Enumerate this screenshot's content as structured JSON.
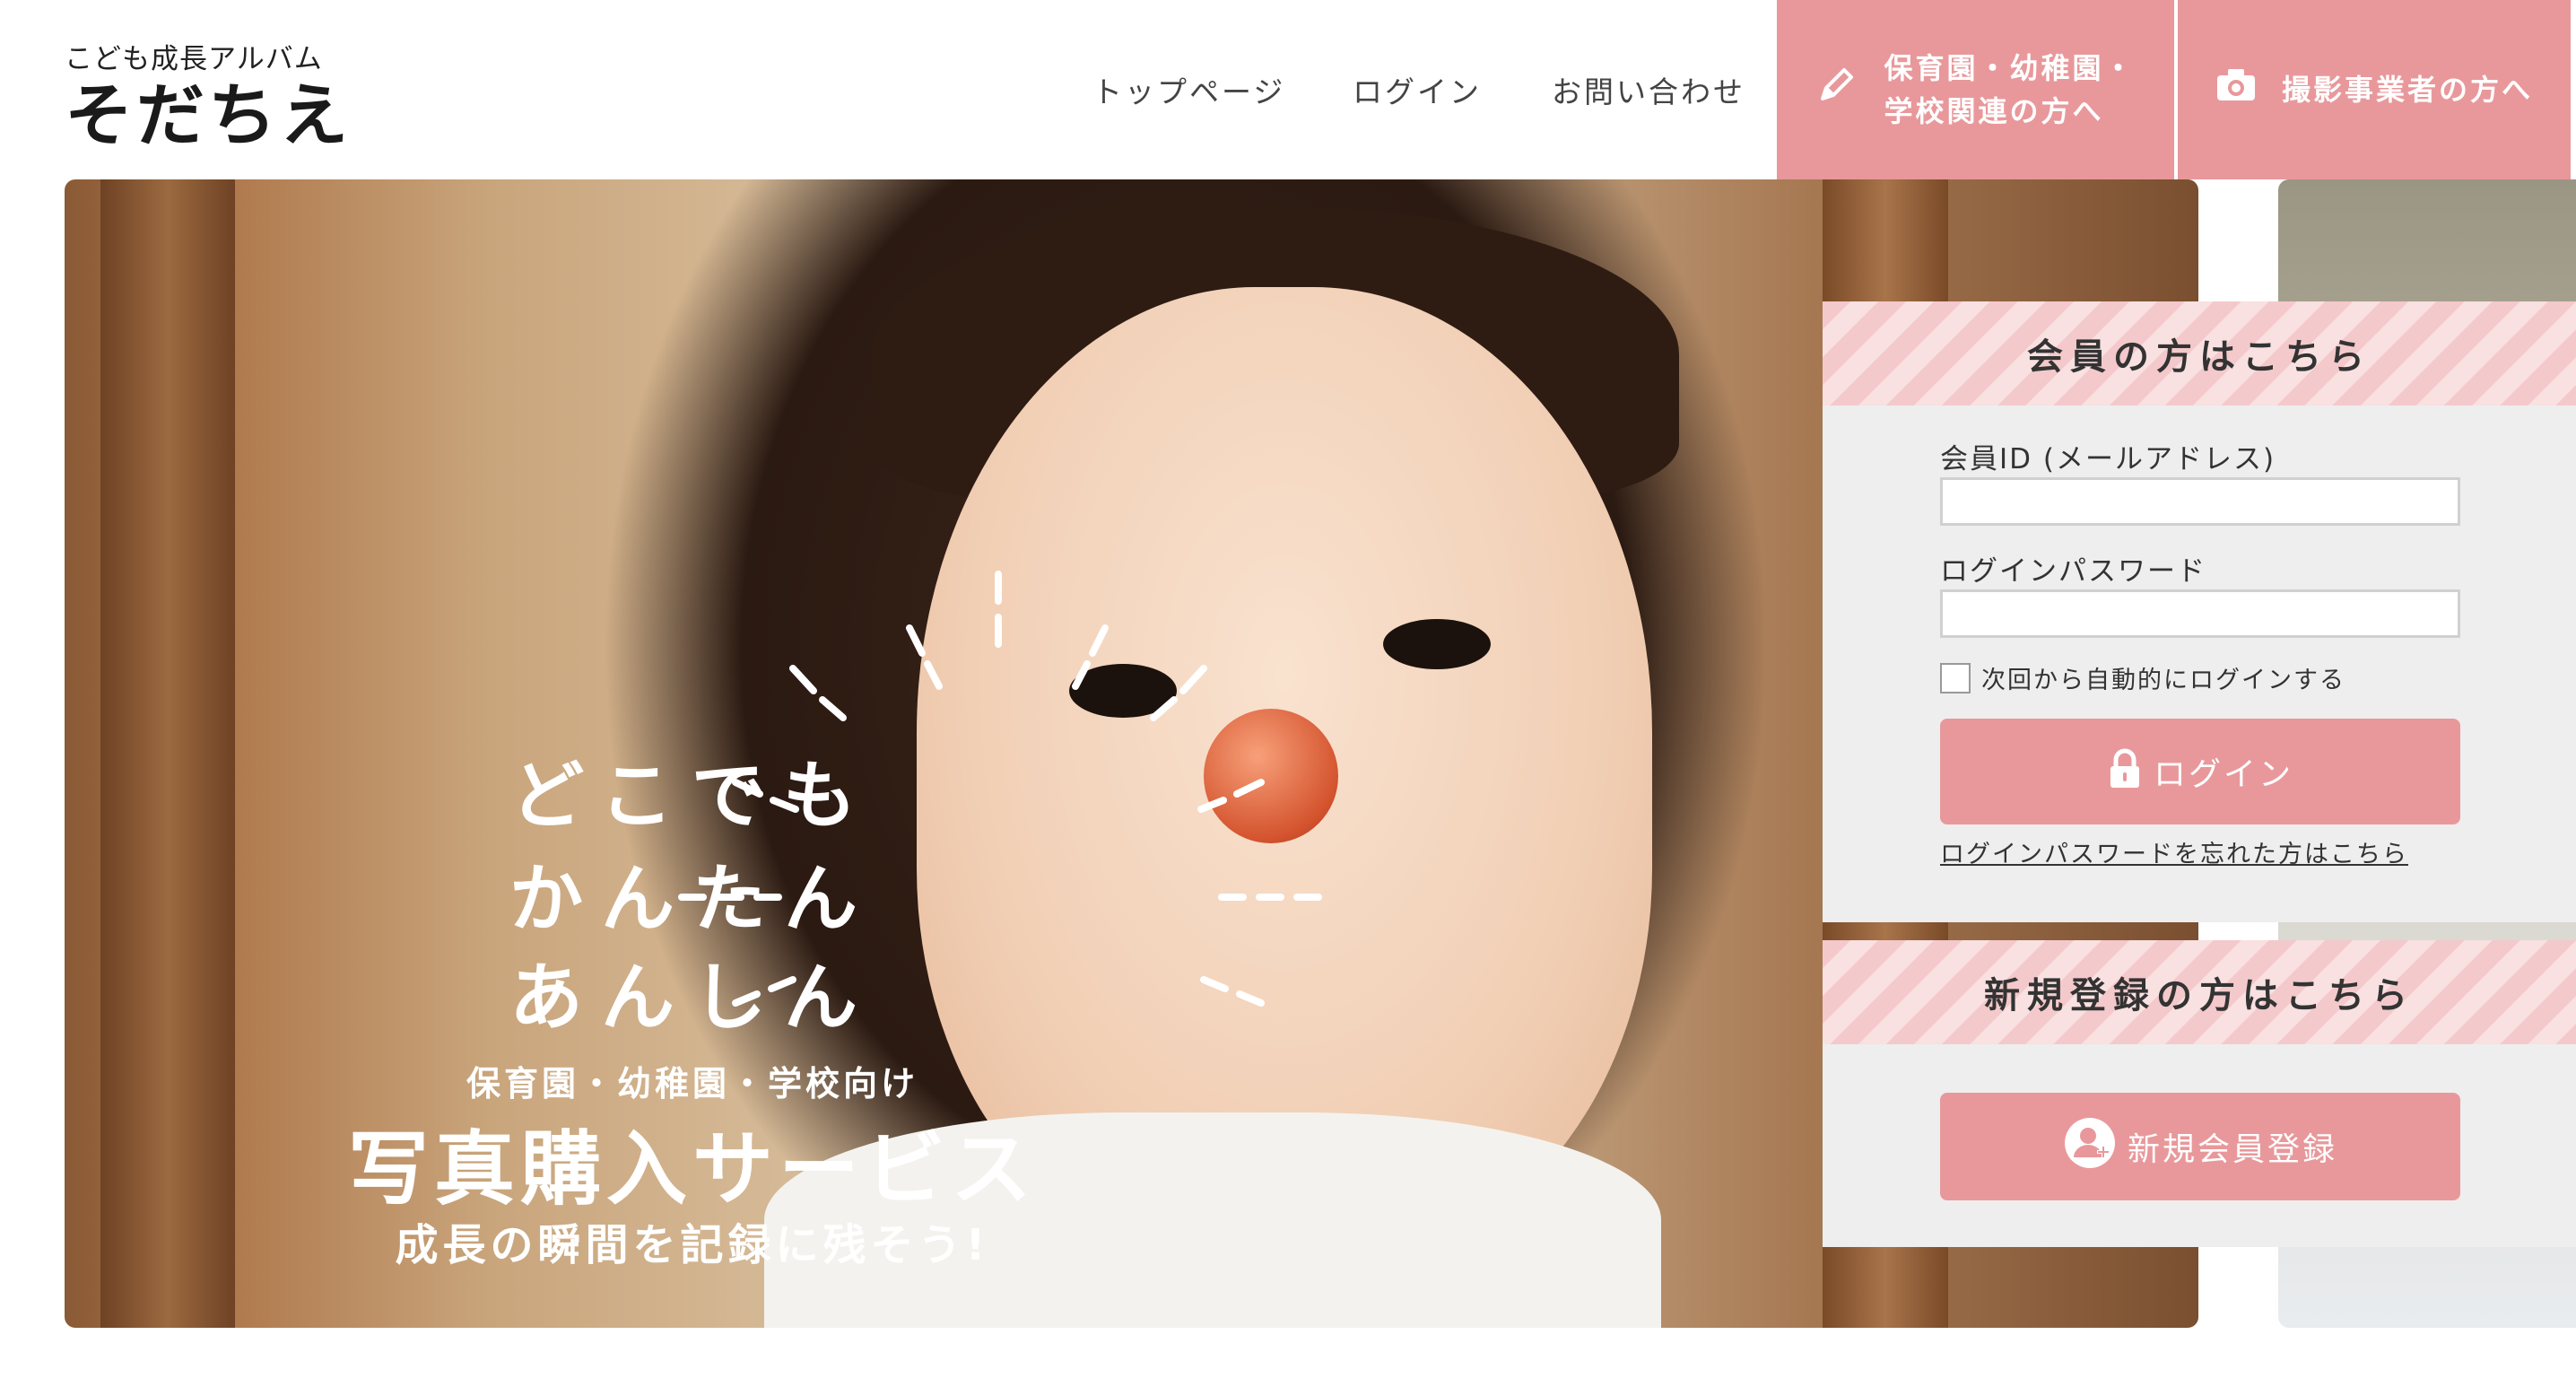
{
  "header": {
    "logo_sub": "こども成長アルバム",
    "logo_main": "そだちえ",
    "nav": {
      "top": "トップページ",
      "login": "ログイン",
      "contact": "お問い合わせ"
    },
    "school_button": {
      "line1": "保育園・幼稚園・",
      "line2": "学校関連の方へ",
      "icon": "pencil-icon"
    },
    "photographer_button": {
      "label": "撮影事業者の方へ",
      "icon": "camera-icon"
    }
  },
  "hero": {
    "line1": "どこでも",
    "line2": "かんたん",
    "line3": "あんしん",
    "subtitle": "保育園・幼稚園・学校向け",
    "title": "写真購入サービス",
    "tagline": "成長の瞬間を記録に残そう!"
  },
  "login_panel": {
    "heading": "会員の方はこちら",
    "id_label": "会員ID (メールアドレス)",
    "id_value": "",
    "password_label": "ログインパスワード",
    "password_value": "",
    "remember_label": "次回から自動的にログインする",
    "remember_checked": false,
    "login_button": "ログイン",
    "login_icon": "lock-icon",
    "forgot_link": "ログインパスワードを忘れた方はこちら"
  },
  "register_panel": {
    "heading": "新規登録の方はこちら",
    "register_button": "新規会員登録",
    "register_icon": "user-add-icon"
  },
  "colors": {
    "accent": "#e8989b",
    "stripe_light": "#f9e0e1",
    "stripe_dark": "#f4c9cb",
    "panel_bg": "#eeeeee"
  }
}
